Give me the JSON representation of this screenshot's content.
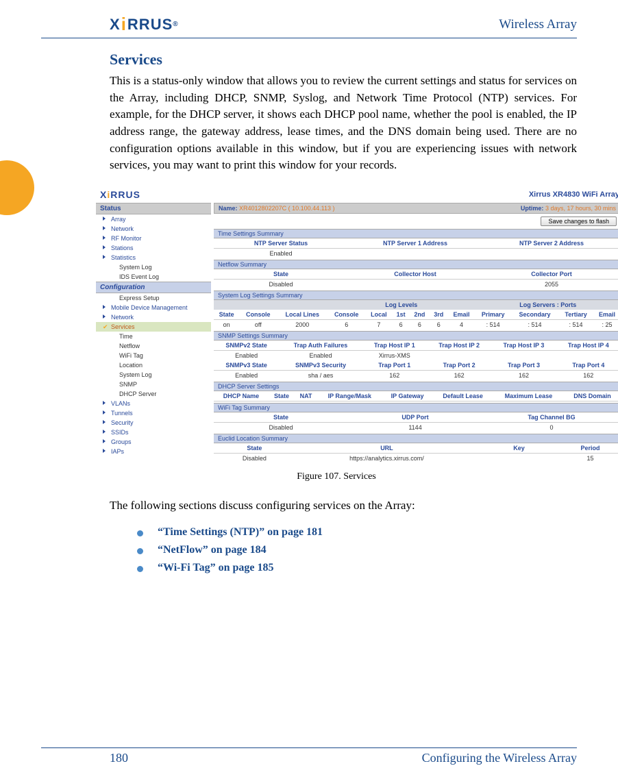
{
  "doc": {
    "header_title": "Wireless Array",
    "logo_text": "XIRRUS",
    "section_title": "Services",
    "para1": "This is a status-only window that allows you to review the current settings and status for services on the Array, including DHCP, SNMP, Syslog, and Network Time Protocol (NTP) services. For example, for the DHCP server, it shows each DHCP pool name, whether the pool is enabled, the IP address range, the gateway address, lease times, and the DNS domain being used. There are no configuration options available in this window, but if you are experiencing issues with network services, you may want to print this window for your records.",
    "figure_caption": "Figure 107. Services",
    "para2": "The following sections discuss configuring services on the Array:",
    "bullets": [
      "“Time Settings (NTP)” on page 181",
      "“NetFlow” on page 184",
      "“Wi-Fi Tag” on page 185"
    ],
    "footer_page": "180",
    "footer_right": "Configuring the Wireless Array"
  },
  "shot": {
    "brand": "XIRRUS",
    "model": "Xirrus XR4830 WiFi Array",
    "name_label": "Name:",
    "name_value": "XR4012802207C   ( 10.100.44.113 )",
    "uptime_label": "Uptime:",
    "uptime_value": "3 days, 17 hours, 30 mins",
    "save_btn": "Save changes to flash",
    "nav": {
      "status_header": "Status",
      "status_items": [
        "Array",
        "Network",
        "RF Monitor",
        "Stations",
        "Statistics",
        "System Log",
        "IDS Event Log"
      ],
      "config_header": "Configuration",
      "config_top": [
        "Express Setup",
        "Mobile Device Management",
        "Network"
      ],
      "services_label": "Services",
      "services_items": [
        "Time",
        "Netflow",
        "WiFi Tag",
        "Location",
        "System Log",
        "SNMP",
        "DHCP Server"
      ],
      "config_bottom": [
        "VLANs",
        "Tunnels",
        "Security",
        "SSIDs",
        "Groups",
        "IAPs"
      ]
    },
    "panels": {
      "time": {
        "title": "Time Settings Summary",
        "headers": [
          "NTP Server Status",
          "NTP Server 1 Address",
          "NTP Server 2 Address"
        ],
        "row": [
          "Enabled",
          "",
          ""
        ]
      },
      "netflow": {
        "title": "Netflow Summary",
        "headers": [
          "State",
          "Collector Host",
          "Collector Port"
        ],
        "row": [
          "Disabled",
          "",
          "2055"
        ]
      },
      "syslog": {
        "title": "System Log Settings Summary",
        "group1": "Log Levels",
        "group2": "Log Servers : Ports",
        "headers": [
          "State",
          "Console",
          "Local Lines",
          "Console",
          "Local",
          "1st",
          "2nd",
          "3rd",
          "Email",
          "Primary",
          "Secondary",
          "Tertiary",
          "Email"
        ],
        "row": [
          "on",
          "off",
          "2000",
          "6",
          "7",
          "6",
          "6",
          "6",
          "4",
          ": 514",
          ": 514",
          ": 514",
          ": 25"
        ]
      },
      "snmp": {
        "title": "SNMP Settings Summary",
        "h1": [
          "SNMPv2 State",
          "Trap Auth Failures",
          "Trap Host IP 1",
          "Trap Host IP 2",
          "Trap Host IP 3",
          "Trap Host IP 4"
        ],
        "r1": [
          "Enabled",
          "Enabled",
          "Xirrus-XMS",
          "",
          "",
          ""
        ],
        "h2": [
          "SNMPv3 State",
          "SNMPv3 Security",
          "Trap Port 1",
          "Trap Port 2",
          "Trap Port 3",
          "Trap Port 4"
        ],
        "r2": [
          "Enabled",
          "sha / aes",
          "162",
          "162",
          "162",
          "162"
        ]
      },
      "dhcp": {
        "title": "DHCP Server Settings",
        "headers": [
          "DHCP Name",
          "State",
          "NAT",
          "IP Range/Mask",
          "IP Gateway",
          "Default Lease",
          "Maximum Lease",
          "DNS Domain"
        ]
      },
      "wifitag": {
        "title": "WiFi Tag Summary",
        "headers": [
          "State",
          "UDP Port",
          "Tag Channel BG"
        ],
        "row": [
          "Disabled",
          "1144",
          "0"
        ]
      },
      "euclid": {
        "title": "Euclid Location Summary",
        "headers": [
          "State",
          "URL",
          "Key",
          "Period"
        ],
        "row": [
          "Disabled",
          "https://analytics.xirrus.com/",
          "",
          "15"
        ]
      }
    }
  }
}
